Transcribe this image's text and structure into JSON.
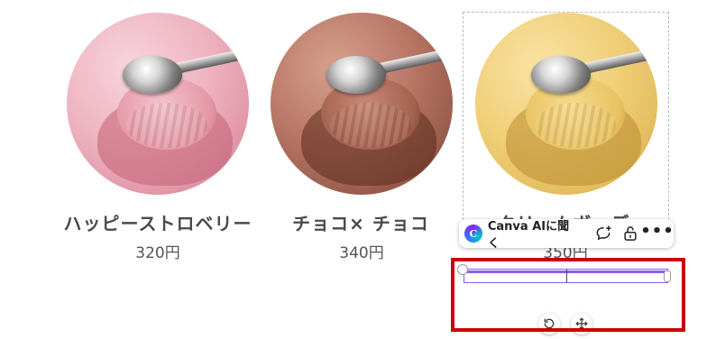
{
  "products": [
    {
      "name": "ハッピーストロベリー",
      "price": "320円"
    },
    {
      "name": "チョコ× チョコ",
      "price": "340円"
    },
    {
      "name": "クリームボーデ",
      "price": "350円"
    }
  ],
  "toolbar": {
    "ai_label": "Canva AIに聞く",
    "ai_logo_letter": "C",
    "more_label": "•••"
  },
  "colors": {
    "selection_accent": "#8b5cf6",
    "highlight": "#cc0000"
  },
  "icons": [
    "comment-add-icon",
    "unlock-icon",
    "more-icon",
    "rotate-icon",
    "move-icon"
  ]
}
